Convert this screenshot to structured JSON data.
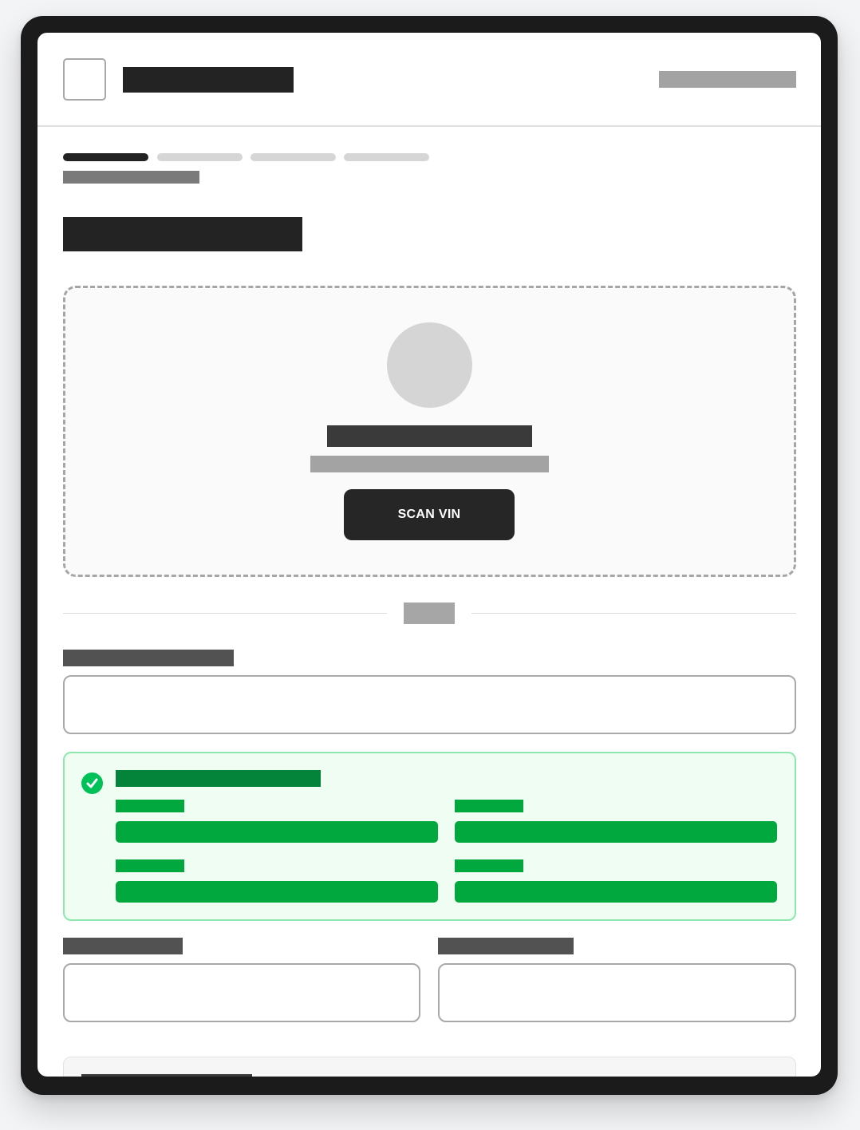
{
  "scan": {
    "button_label": "SCAN VIN"
  },
  "steps": {
    "total": 4,
    "current": 1
  },
  "vin_field": {
    "value": "",
    "placeholder": ""
  },
  "bottom_fields": [
    {
      "value": "",
      "placeholder": ""
    },
    {
      "value": "",
      "placeholder": ""
    }
  ],
  "colors": {
    "frame": "#1b1b1b",
    "text_dark": "#232323",
    "success_border": "#8ee8ae",
    "success_bg": "#f0fdf3",
    "success_fill": "#00a83d",
    "success_title": "#04833a",
    "check_icon": "#00c157"
  },
  "icons": {
    "logo": "logo-placeholder",
    "camera": "camera-icon",
    "decoded": "check-circle-icon"
  }
}
